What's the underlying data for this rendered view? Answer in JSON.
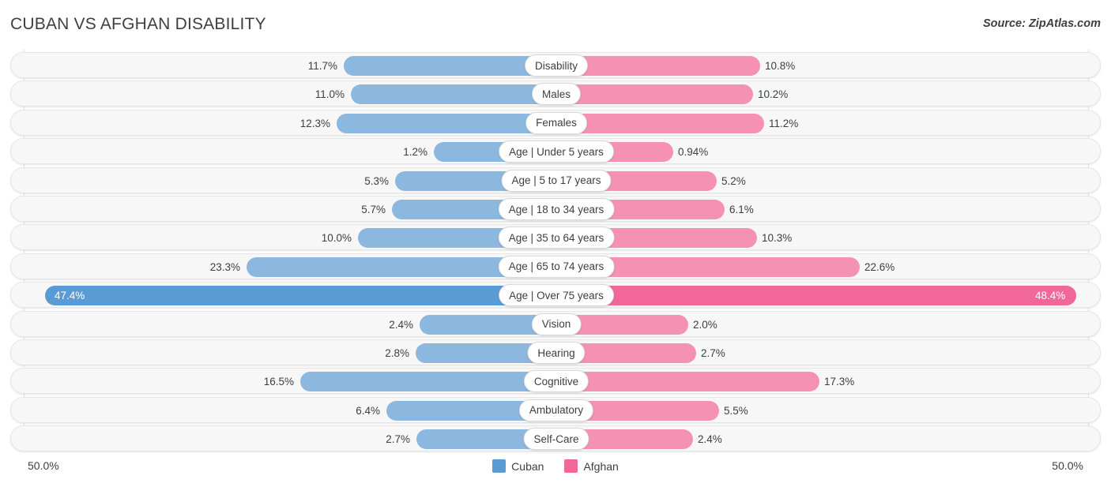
{
  "header": {
    "title": "CUBAN VS AFGHAN DISABILITY",
    "source": "Source: ZipAtlas.com"
  },
  "axis": {
    "left_label": "50.0%",
    "right_label": "50.0%"
  },
  "legend": {
    "items": [
      {
        "label": "Cuban",
        "color": "#5b9bd5"
      },
      {
        "label": "Afghan",
        "color": "#f2679a"
      }
    ]
  },
  "colors": {
    "left_bar": "#8cb8e0",
    "right_bar": "#f591b2",
    "left_bar_highlight": "#5b9bd5",
    "right_bar_highlight": "#f2679a",
    "track": "#f7f7f7",
    "gridline": "#e2e2e2"
  },
  "chart_data": {
    "type": "bar",
    "title": "CUBAN VS AFGHAN DISABILITY",
    "subtitle": "Source: ZipAtlas.com",
    "orientation": "horizontal-diverging",
    "xlabel": "",
    "ylabel": "",
    "xlim": [
      -50.0,
      50.0
    ],
    "axis_left_max": "50.0%",
    "axis_right_max": "50.0%",
    "grid": true,
    "legend_position": "bottom-center",
    "categories": [
      "Disability",
      "Males",
      "Females",
      "Age | Under 5 years",
      "Age | 5 to 17 years",
      "Age | 18 to 34 years",
      "Age | 35 to 64 years",
      "Age | 65 to 74 years",
      "Age | Over 75 years",
      "Vision",
      "Hearing",
      "Cognitive",
      "Ambulatory",
      "Self-Care"
    ],
    "series": [
      {
        "name": "Cuban",
        "color": "#5b9bd5",
        "values": [
          11.7,
          11.0,
          12.3,
          1.2,
          5.3,
          5.7,
          10.0,
          23.3,
          47.4,
          2.4,
          2.8,
          16.5,
          6.4,
          2.7
        ],
        "labels": [
          "11.7%",
          "11.0%",
          "12.3%",
          "1.2%",
          "5.3%",
          "5.7%",
          "10.0%",
          "23.3%",
          "47.4%",
          "2.4%",
          "2.8%",
          "16.5%",
          "6.4%",
          "2.7%"
        ]
      },
      {
        "name": "Afghan",
        "color": "#f2679a",
        "values": [
          10.8,
          10.2,
          11.2,
          0.94,
          5.2,
          6.1,
          10.3,
          22.6,
          48.4,
          2.0,
          2.7,
          17.3,
          5.5,
          2.4
        ],
        "labels": [
          "10.8%",
          "10.2%",
          "11.2%",
          "0.94%",
          "5.2%",
          "6.1%",
          "10.3%",
          "22.6%",
          "48.4%",
          "2.0%",
          "2.7%",
          "17.3%",
          "5.5%",
          "2.4%"
        ]
      }
    ],
    "highlighted_category": "Age | Over 75 years"
  },
  "rows": [
    {
      "category": "Disability",
      "left_label": "11.7%",
      "right_label": "10.8%",
      "left_w": 269,
      "right_w": 258,
      "highlight": false,
      "inside": false
    },
    {
      "category": "Males",
      "left_label": "11.0%",
      "right_label": "10.2%",
      "left_w": 260,
      "right_w": 249,
      "highlight": false,
      "inside": false
    },
    {
      "category": "Females",
      "left_label": "12.3%",
      "right_label": "11.2%",
      "left_w": 278,
      "right_w": 263,
      "highlight": false,
      "inside": false
    },
    {
      "category": "Age | Under 5 years",
      "left_label": "1.2%",
      "right_label": "0.94%",
      "left_w": 155,
      "right_w": 148,
      "highlight": false,
      "inside": false
    },
    {
      "category": "Age | 5 to 17 years",
      "left_label": "5.3%",
      "right_label": "5.2%",
      "left_w": 204,
      "right_w": 203,
      "highlight": false,
      "inside": false
    },
    {
      "category": "Age | 18 to 34 years",
      "left_label": "5.7%",
      "right_label": "6.1%",
      "left_w": 208,
      "right_w": 213,
      "highlight": false,
      "inside": false
    },
    {
      "category": "Age | 35 to 64 years",
      "left_label": "10.0%",
      "right_label": "10.3%",
      "left_w": 251,
      "right_w": 254,
      "highlight": false,
      "inside": false
    },
    {
      "category": "Age | 65 to 74 years",
      "left_label": "23.3%",
      "right_label": "22.6%",
      "left_w": 392,
      "right_w": 384,
      "highlight": false,
      "inside": false
    },
    {
      "category": "Age | Over 75 years",
      "left_label": "47.4%",
      "right_label": "48.4%",
      "left_w": 647,
      "right_w": 658,
      "highlight": true,
      "inside": true
    },
    {
      "category": "Vision",
      "left_label": "2.4%",
      "right_label": "2.0%",
      "left_w": 173,
      "right_w": 167,
      "highlight": false,
      "inside": false
    },
    {
      "category": "Hearing",
      "left_label": "2.8%",
      "right_label": "2.7%",
      "left_w": 178,
      "right_w": 177,
      "highlight": false,
      "inside": false
    },
    {
      "category": "Cognitive",
      "left_label": "16.5%",
      "right_label": "17.3%",
      "left_w": 324,
      "right_w": 333,
      "highlight": false,
      "inside": false
    },
    {
      "category": "Ambulatory",
      "left_label": "6.4%",
      "right_label": "5.5%",
      "left_w": 215,
      "right_w": 206,
      "highlight": false,
      "inside": false
    },
    {
      "category": "Self-Care",
      "left_label": "2.7%",
      "right_label": "2.4%",
      "left_w": 177,
      "right_w": 173,
      "highlight": false,
      "inside": false
    }
  ]
}
